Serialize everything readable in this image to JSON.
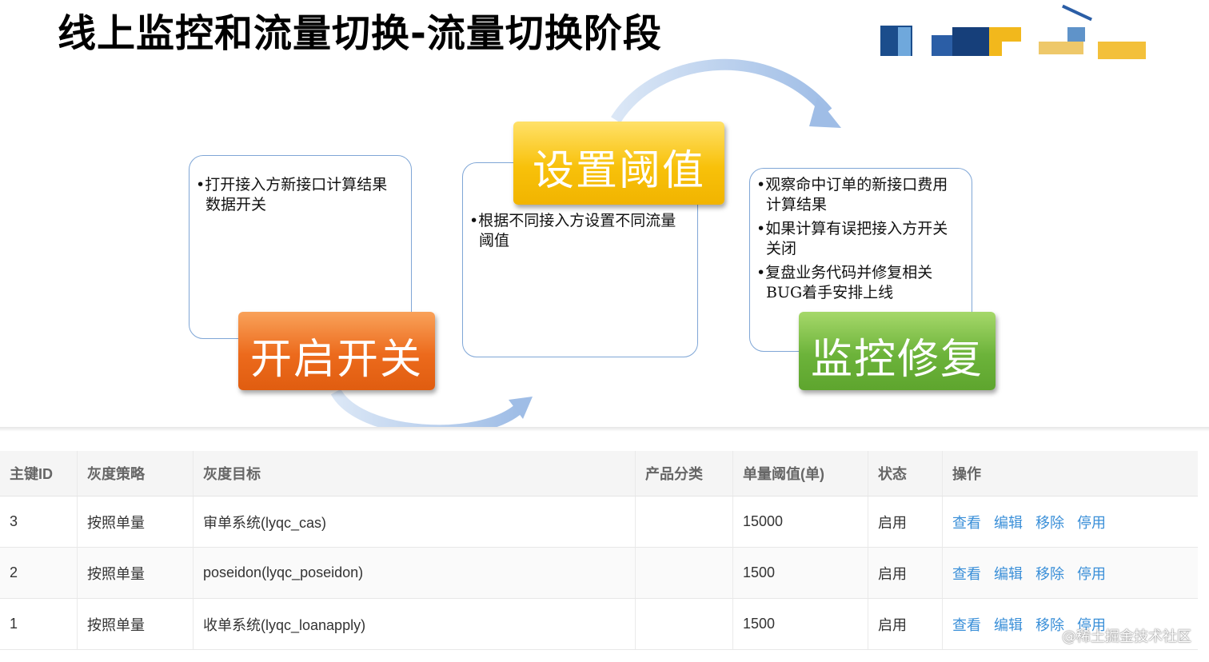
{
  "slide": {
    "title": "线上监控和流量切换-流量切换阶段",
    "stages": [
      {
        "label": "开启开关",
        "bullets": [
          "打开接入方新接口计算结果数据开关"
        ]
      },
      {
        "label": "设置阈值",
        "bullets": [
          "根据不同接入方设置不同流量阈值"
        ]
      },
      {
        "label": "监控修复",
        "bullets": [
          "观察命中订单的新接口费用计算结果",
          "如果计算有误把接入方开关关闭",
          "复盘业务代码并修复相关BUG着手安排上线"
        ]
      }
    ],
    "colors": {
      "orange": "#ec6a1c",
      "yellow": "#f8c10a",
      "green": "#6cb33a",
      "arrow": "#a9c4e8"
    }
  },
  "table": {
    "headers": [
      "主键ID",
      "灰度策略",
      "灰度目标",
      "产品分类",
      "单量阈值(单)",
      "状态",
      "操作"
    ],
    "rows": [
      {
        "id": "3",
        "strategy": "按照单量",
        "target": "审单系统(lyqc_cas)",
        "category": "",
        "threshold": "15000",
        "status": "启用"
      },
      {
        "id": "2",
        "strategy": "按照单量",
        "target": "poseidon(lyqc_poseidon)",
        "category": "",
        "threshold": "1500",
        "status": "启用"
      },
      {
        "id": "1",
        "strategy": "按照单量",
        "target": "收单系统(lyqc_loanapply)",
        "category": "",
        "threshold": "1500",
        "status": "启用"
      }
    ],
    "actions": [
      "查看",
      "编辑",
      "移除",
      "停用"
    ],
    "link_color": "#3a8fd8"
  },
  "watermark": "@稀土掘金技术社区"
}
